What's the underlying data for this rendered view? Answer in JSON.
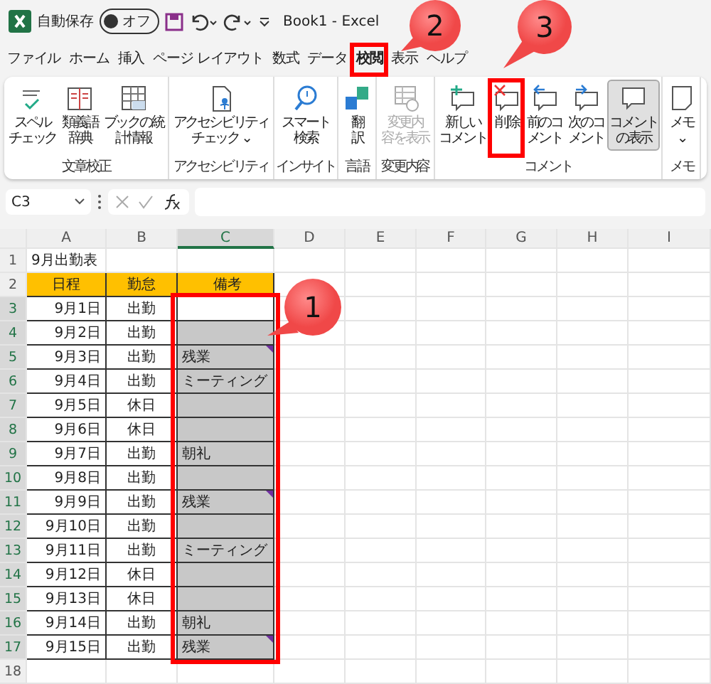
{
  "title_bar": {
    "autosave_label": "自動保存",
    "autosave_toggle": {
      "label": "オフ",
      "on": false
    },
    "document_title": "Book1  -  Excel"
  },
  "tabs": [
    {
      "label": "ファイル",
      "selected": false,
      "highlighted": false
    },
    {
      "label": "ホーム",
      "selected": false,
      "highlighted": false
    },
    {
      "label": "挿入",
      "selected": false,
      "highlighted": false
    },
    {
      "label": "ページ レイアウト",
      "selected": false,
      "highlighted": false
    },
    {
      "label": "数式",
      "selected": false,
      "highlighted": false
    },
    {
      "label": "データ",
      "selected": false,
      "highlighted": false
    },
    {
      "label": "校閲",
      "selected": true,
      "highlighted": true
    },
    {
      "label": "表示",
      "selected": false,
      "highlighted": false
    },
    {
      "label": "ヘルプ",
      "selected": false,
      "highlighted": false
    }
  ],
  "ribbon_groups": [
    {
      "label": "文章校正",
      "buttons": [
        {
          "lines": [
            "スペル",
            "チェック"
          ],
          "disabled": false,
          "selected": false,
          "highlighted": false
        },
        {
          "lines": [
            "類義語",
            "辞典"
          ],
          "disabled": false,
          "selected": false,
          "highlighted": false
        },
        {
          "lines": [
            "ブックの統",
            "計情報"
          ],
          "disabled": false,
          "selected": false,
          "highlighted": false
        }
      ]
    },
    {
      "label": "アクセシビリティ",
      "buttons": [
        {
          "lines": [
            "アクセシビリティ",
            "チェック ⌄"
          ],
          "disabled": false,
          "selected": false,
          "highlighted": false
        }
      ]
    },
    {
      "label": "インサイト",
      "buttons": [
        {
          "lines": [
            "スマート",
            "検索"
          ],
          "disabled": false,
          "selected": false,
          "highlighted": false
        }
      ]
    },
    {
      "label": "言語",
      "buttons": [
        {
          "lines": [
            "翻",
            "訳"
          ],
          "disabled": false,
          "selected": false,
          "highlighted": false
        }
      ]
    },
    {
      "label": "変更内容",
      "buttons": [
        {
          "lines": [
            "変更内",
            "容を表示"
          ],
          "disabled": true,
          "selected": false,
          "highlighted": false
        }
      ]
    },
    {
      "label": "コメント",
      "buttons": [
        {
          "lines": [
            "新しい",
            "コメント"
          ],
          "disabled": false,
          "selected": false,
          "highlighted": false
        },
        {
          "lines": [
            "削除"
          ],
          "disabled": false,
          "selected": false,
          "highlighted": true
        },
        {
          "lines": [
            "前のコ",
            "メント"
          ],
          "disabled": false,
          "selected": false,
          "highlighted": false
        },
        {
          "lines": [
            "次のコ",
            "メント"
          ],
          "disabled": false,
          "selected": false,
          "highlighted": false
        },
        {
          "lines": [
            "コメント",
            "の表示"
          ],
          "disabled": false,
          "selected": true,
          "highlighted": false
        }
      ]
    },
    {
      "label": "メモ",
      "buttons": [
        {
          "lines": [
            "メモ",
            "⌄"
          ],
          "disabled": false,
          "selected": false,
          "highlighted": false
        }
      ]
    }
  ],
  "formula_bar": {
    "name_box": "C3"
  },
  "columns": [
    "A",
    "B",
    "C",
    "D",
    "E",
    "F",
    "G",
    "H",
    "I"
  ],
  "rows": [
    {
      "number": "1",
      "cells": [
        "9月出勤表",
        "",
        ""
      ],
      "selected": false
    },
    {
      "number": "2",
      "cells": [
        "日程",
        "勤怠",
        "備考"
      ],
      "selected": false
    },
    {
      "number": "3",
      "cells": [
        "9月1日",
        "出勤",
        ""
      ],
      "selected": true,
      "comment": false
    },
    {
      "number": "4",
      "cells": [
        "9月2日",
        "出勤",
        ""
      ],
      "selected": true,
      "comment": false
    },
    {
      "number": "5",
      "cells": [
        "9月3日",
        "出勤",
        "残業"
      ],
      "selected": true,
      "comment": true
    },
    {
      "number": "6",
      "cells": [
        "9月4日",
        "出勤",
        "ミーティング"
      ],
      "selected": true,
      "comment": false
    },
    {
      "number": "7",
      "cells": [
        "9月5日",
        "休日",
        ""
      ],
      "selected": true,
      "comment": false
    },
    {
      "number": "8",
      "cells": [
        "9月6日",
        "休日",
        ""
      ],
      "selected": true,
      "comment": false
    },
    {
      "number": "9",
      "cells": [
        "9月7日",
        "出勤",
        "朝礼"
      ],
      "selected": true,
      "comment": false
    },
    {
      "number": "10",
      "cells": [
        "9月8日",
        "出勤",
        ""
      ],
      "selected": true,
      "comment": false
    },
    {
      "number": "11",
      "cells": [
        "9月9日",
        "出勤",
        "残業"
      ],
      "selected": true,
      "comment": true
    },
    {
      "number": "12",
      "cells": [
        "9月10日",
        "出勤",
        ""
      ],
      "selected": true,
      "comment": false
    },
    {
      "number": "13",
      "cells": [
        "9月11日",
        "出勤",
        "ミーティング"
      ],
      "selected": true,
      "comment": false
    },
    {
      "number": "14",
      "cells": [
        "9月12日",
        "休日",
        ""
      ],
      "selected": true,
      "comment": false
    },
    {
      "number": "15",
      "cells": [
        "9月13日",
        "休日",
        ""
      ],
      "selected": true,
      "comment": false
    },
    {
      "number": "16",
      "cells": [
        "9月14日",
        "出勤",
        "朝礼"
      ],
      "selected": true,
      "comment": false
    },
    {
      "number": "17",
      "cells": [
        "9月15日",
        "出勤",
        "残業"
      ],
      "selected": true,
      "comment": true
    },
    {
      "number": "18",
      "cells": [
        "",
        "",
        ""
      ],
      "selected": false
    }
  ],
  "callouts": [
    {
      "label": "1"
    },
    {
      "label": "2"
    },
    {
      "label": "3"
    }
  ]
}
